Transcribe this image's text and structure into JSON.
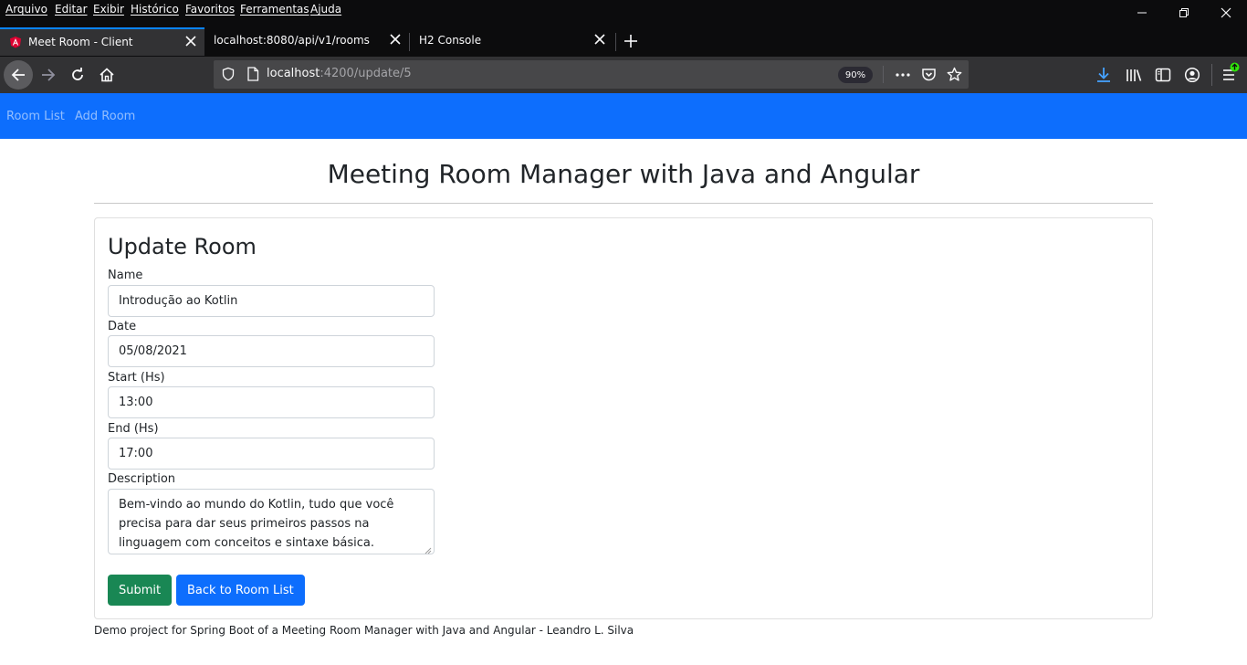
{
  "browser": {
    "menu": [
      "Arquivo",
      "Editar",
      "Exibir",
      "Histórico",
      "Favoritos",
      "Ferramentas",
      "Ajuda"
    ],
    "tabs": [
      {
        "title": "Meet Room - Client",
        "active": true
      },
      {
        "title": "localhost:8080/api/v1/rooms",
        "active": false
      },
      {
        "title": "H2 Console",
        "active": false
      }
    ],
    "url_host": "localhost",
    "url_path": ":4200/update/5",
    "zoom": "90%",
    "accent_color": "#0a84ff"
  },
  "app": {
    "nav": {
      "links": [
        "Room List",
        "Add Room"
      ],
      "color": "#0d6efd"
    },
    "page_title": "Meeting Room Manager with Java and Angular",
    "form": {
      "title": "Update Room",
      "fields": [
        {
          "label": "Name",
          "value": "Introdução ao Kotlin"
        },
        {
          "label": "Date",
          "value": "05/08/2021"
        },
        {
          "label": "Start (Hs)",
          "value": "13:00"
        },
        {
          "label": "End (Hs)",
          "value": "17:00"
        }
      ],
      "description_label": "Description",
      "description_value": "Bem-vindo ao mundo do Kotlin, tudo que você precisa para dar seus primeiros passos na linguagem com conceitos e sintaxe básica.",
      "submit_label": "Submit",
      "back_label": "Back to Room List"
    },
    "footer": "Demo project for Spring Boot of a Meeting Room Manager with Java and Angular - Leandro L. Silva"
  }
}
